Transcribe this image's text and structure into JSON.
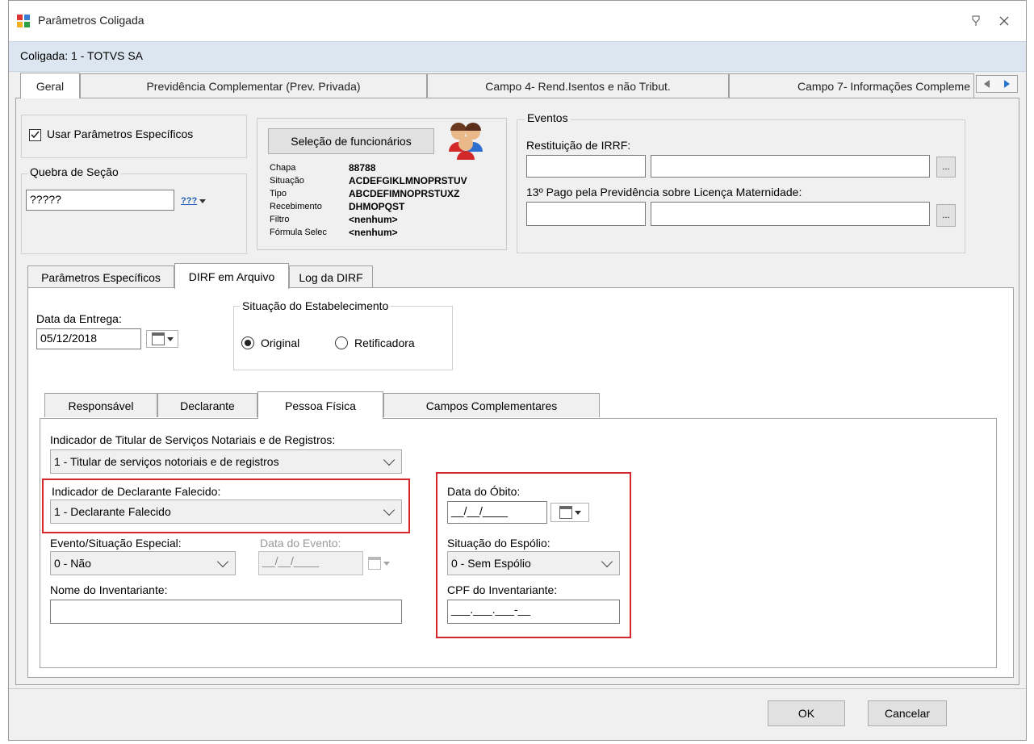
{
  "window": {
    "title": "Parâmetros Coligada",
    "subtitle": "Coligada: 1 - TOTVS SA",
    "restore_icon": "restore-icon",
    "close_icon": "close-icon"
  },
  "main_tabs": [
    {
      "label": "Geral",
      "active": true
    },
    {
      "label": "Previdência Complementar (Prev. Privada)"
    },
    {
      "label": "Campo 4- Rend.Isentos e não Tribut."
    },
    {
      "label": "Campo 7- Informações Compleme"
    }
  ],
  "usar_parametros": {
    "label": "Usar Parâmetros Específicos",
    "checked": true
  },
  "quebra": {
    "legend": "Quebra de Seção",
    "value": "?????",
    "btn": "???"
  },
  "selecao": {
    "button": "Seleção de funcionários",
    "rows": [
      {
        "key": "Chapa",
        "value": "88788"
      },
      {
        "key": "Situação",
        "value": "ACDEFGIKLMNOPRSTUV"
      },
      {
        "key": "Tipo",
        "value": "ABCDEFIMNOPRSTUXZ"
      },
      {
        "key": "Recebimento",
        "value": "DHMOPQST"
      },
      {
        "key": "Filtro",
        "value": "<nenhum>"
      },
      {
        "key": "Fórmula Selec",
        "value": "<nenhum>"
      }
    ]
  },
  "eventos": {
    "legend": "Eventos",
    "restituicao_label": "Restituição de IRRF:",
    "decimo_label": "13º Pago pela Previdência sobre Licença Maternidade:",
    "ellipsis": "..."
  },
  "sub_tabs": [
    {
      "label": "Parâmetros Específicos"
    },
    {
      "label": "DIRF em Arquivo",
      "active": true
    },
    {
      "label": "Log da DIRF"
    }
  ],
  "data_entrega": {
    "label": "Data da Entrega:",
    "value": "05/12/2018"
  },
  "situacao_estab": {
    "legend": "Situação do Estabelecimento",
    "options": [
      "Original",
      "Retificadora"
    ],
    "selected": "Original"
  },
  "inner_tabs": [
    {
      "label": "Responsável"
    },
    {
      "label": "Declarante"
    },
    {
      "label": "Pessoa Física",
      "active": true
    },
    {
      "label": "Campos Complementares"
    }
  ],
  "pf": {
    "titular_label": "Indicador de Titular de Serviços Notariais e de Registros:",
    "titular_value": "1 - Titular de serviços notoriais e de registros",
    "falecido_label": "Indicador de Declarante Falecido:",
    "falecido_value": "1 - Declarante Falecido",
    "evento_label": "Evento/Situação Especial:",
    "evento_value": "0 - Não",
    "data_evento_label": "Data do Evento:",
    "data_evento_value": "__/__/____",
    "nome_label": "Nome do Inventariante:",
    "nome_value": "",
    "obito_label": "Data do Óbito:",
    "obito_value": "__/__/____",
    "espolio_label": "Situação do Espólio:",
    "espolio_value": "0 - Sem Espólio",
    "cpf_label": "CPF do Inventariante:",
    "cpf_value": "___.___.___-__"
  },
  "footer": {
    "ok": "OK",
    "cancel": "Cancelar"
  }
}
